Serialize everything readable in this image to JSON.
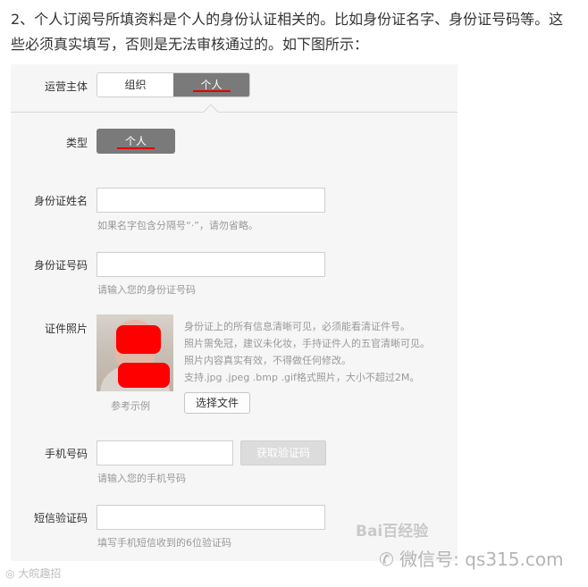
{
  "intro_text": "2、个人订阅号所填资料是个人的身份认证相关的。比如身份证名字、身份证号码等。这些必须真实填写，否则是无法审核通过的。如下图所示：",
  "subject": {
    "label": "运营主体",
    "options": [
      "组织",
      "个人"
    ],
    "selected": "个人"
  },
  "type": {
    "label": "类型",
    "value": "个人"
  },
  "id_name": {
    "label": "身份证姓名",
    "value": "",
    "hint": "如果名字包含分隔号“·”，请勿省略。"
  },
  "id_number": {
    "label": "身份证号码",
    "value": "",
    "hint": "请输入您的身份证号码"
  },
  "id_photo": {
    "label": "证件照片",
    "sample_caption": "参考示例",
    "info_lines": [
      "身份证上的所有信息清晰可见，必须能看清证件号。",
      "照片需免冠，建议未化妆，手持证件人的五官清晰可见。",
      "照片内容真实有效，不得做任何修改。",
      "支持.jpg .jpeg .bmp .gif格式照片，大小不超过2M。"
    ],
    "upload_button": "选择文件"
  },
  "phone": {
    "label": "手机号码",
    "value": "",
    "hint": "请输入您的手机号码",
    "get_code_button": "获取验证码"
  },
  "sms_code": {
    "label": "短信验证码",
    "value": "",
    "hint": "填写手机短信收到的6位验证码"
  },
  "watermarks": {
    "baidu": "Bai百经验",
    "wechat": "微信号: qs315.com",
    "corner": "大皖趣招"
  }
}
